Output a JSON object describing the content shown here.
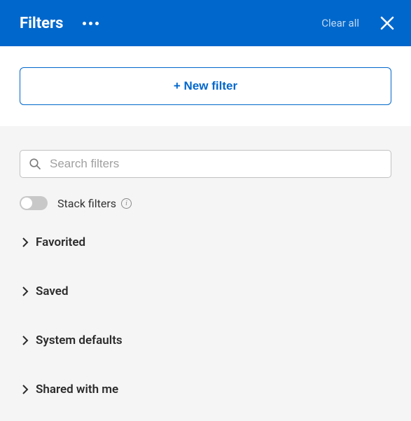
{
  "header": {
    "title": "Filters",
    "clear_all": "Clear all"
  },
  "new_filter": {
    "label": "+ New filter"
  },
  "search": {
    "placeholder": "Search filters",
    "value": ""
  },
  "stack": {
    "label": "Stack filters",
    "enabled": false
  },
  "categories": [
    {
      "label": "Favorited"
    },
    {
      "label": "Saved"
    },
    {
      "label": "System defaults"
    },
    {
      "label": "Shared with me"
    }
  ]
}
